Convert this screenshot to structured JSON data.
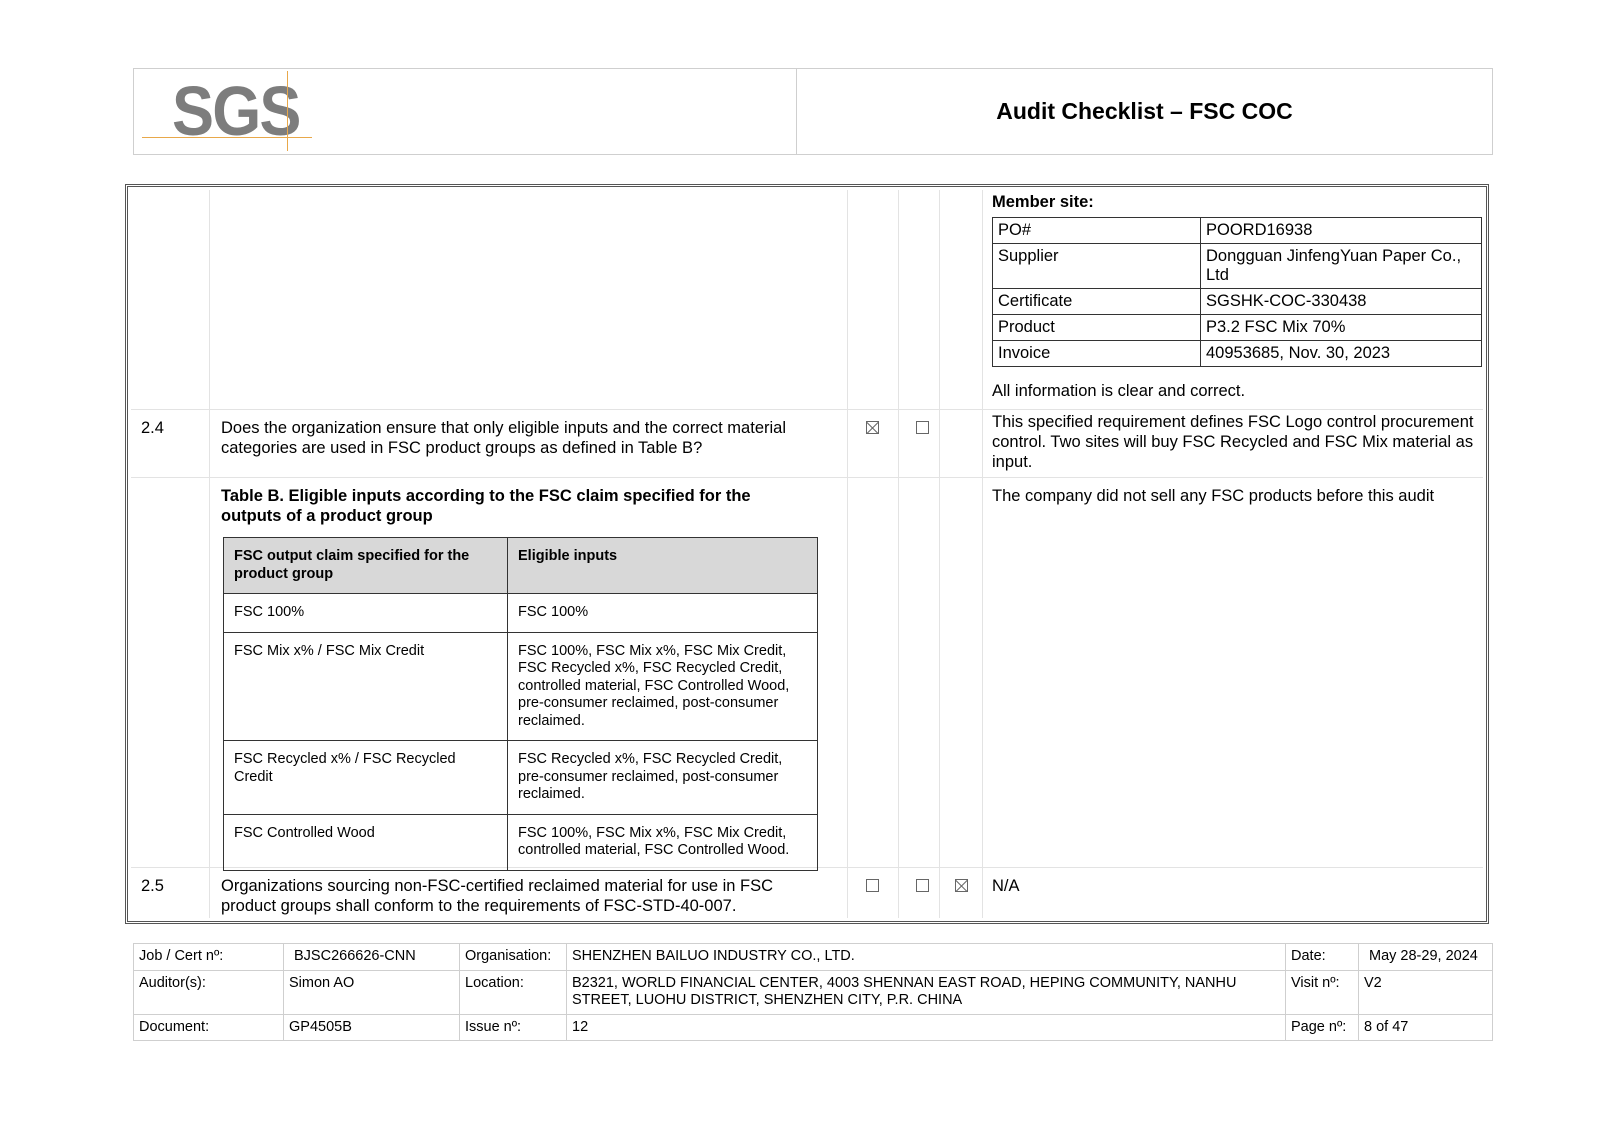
{
  "header": {
    "logo_text": "SGS",
    "title": "Audit Checklist – FSC COC"
  },
  "top_section": {
    "member_site_label": "Member site:",
    "member_rows": [
      {
        "label": "PO#",
        "value": "POORD16938"
      },
      {
        "label": "Supplier",
        "value": "Dongguan JinfengYuan Paper Co., Ltd"
      },
      {
        "label": "Certificate",
        "value": "SGSHK-COC-330438"
      },
      {
        "label": "Product",
        "value": "P3.2   FSC Mix 70%"
      },
      {
        "label": "Invoice",
        "value": "40953685,  Nov. 30, 2023"
      }
    ],
    "note": "All information is clear and correct."
  },
  "row_2_4": {
    "number": "2.4",
    "question": "Does the organization ensure that only eligible inputs and the correct material categories are used in FSC product groups as defined in Table B?",
    "checkbox_yes": true,
    "checkbox_no": false,
    "comment": "This specified requirement defines FSC Logo control procurement control. Two sites will buy FSC Recycled and FSC Mix material as input."
  },
  "table_b_row": {
    "title": "Table B. Eligible inputs according to the FSC claim specified for the outputs of a product group",
    "comment": "The  company did not sell any FSC products before this audit",
    "headers": [
      "FSC output claim specified for the product group",
      "Eligible inputs"
    ],
    "rows": [
      [
        "FSC 100%",
        "FSC 100%"
      ],
      [
        "FSC Mix x% / FSC Mix Credit",
        "FSC 100%, FSC Mix x%, FSC Mix Credit, FSC Recycled x%, FSC Recycled Credit, controlled material, FSC Controlled Wood, pre-consumer reclaimed, post-consumer reclaimed."
      ],
      [
        "FSC Recycled x% / FSC Recycled Credit",
        "FSC Recycled x%, FSC Recycled Credit, pre-consumer reclaimed, post-consumer reclaimed."
      ],
      [
        "FSC Controlled Wood",
        "FSC 100%, FSC Mix x%, FSC Mix Credit, controlled material, FSC Controlled Wood."
      ]
    ]
  },
  "row_2_5": {
    "number": "2.5",
    "question": "Organizations sourcing non-FSC-certified reclaimed material for use in FSC product groups shall conform to the requirements of FSC-STD-40-007.",
    "checkbox_yes": false,
    "checkbox_no": false,
    "checkbox_na": true,
    "comment": "N/A"
  },
  "footer": {
    "job_label": "Job / Cert nº:",
    "job_value": "BJSC266626-CNN",
    "org_label": "Organisation:",
    "org_value": "SHENZHEN BAILUO INDUSTRY CO., LTD.",
    "date_label": "Date:",
    "date_value": "May 28-29, 2024",
    "auditor_label": "Auditor(s):",
    "auditor_value": "Simon AO",
    "location_label": "Location:",
    "location_value": "B2321, WORLD FINANCIAL CENTER, 4003 SHENNAN EAST ROAD, HEPING COMMUNITY, NANHU STREET, LUOHU DISTRICT, SHENZHEN CITY, P.R. CHINA",
    "visit_label": "Visit nº:",
    "visit_value": "V2",
    "doc_label": "Document:",
    "doc_value": "GP4505B",
    "issue_label": "Issue nº:",
    "issue_value": "12",
    "page_label": "Page nº:",
    "page_value": "8 of 47"
  }
}
